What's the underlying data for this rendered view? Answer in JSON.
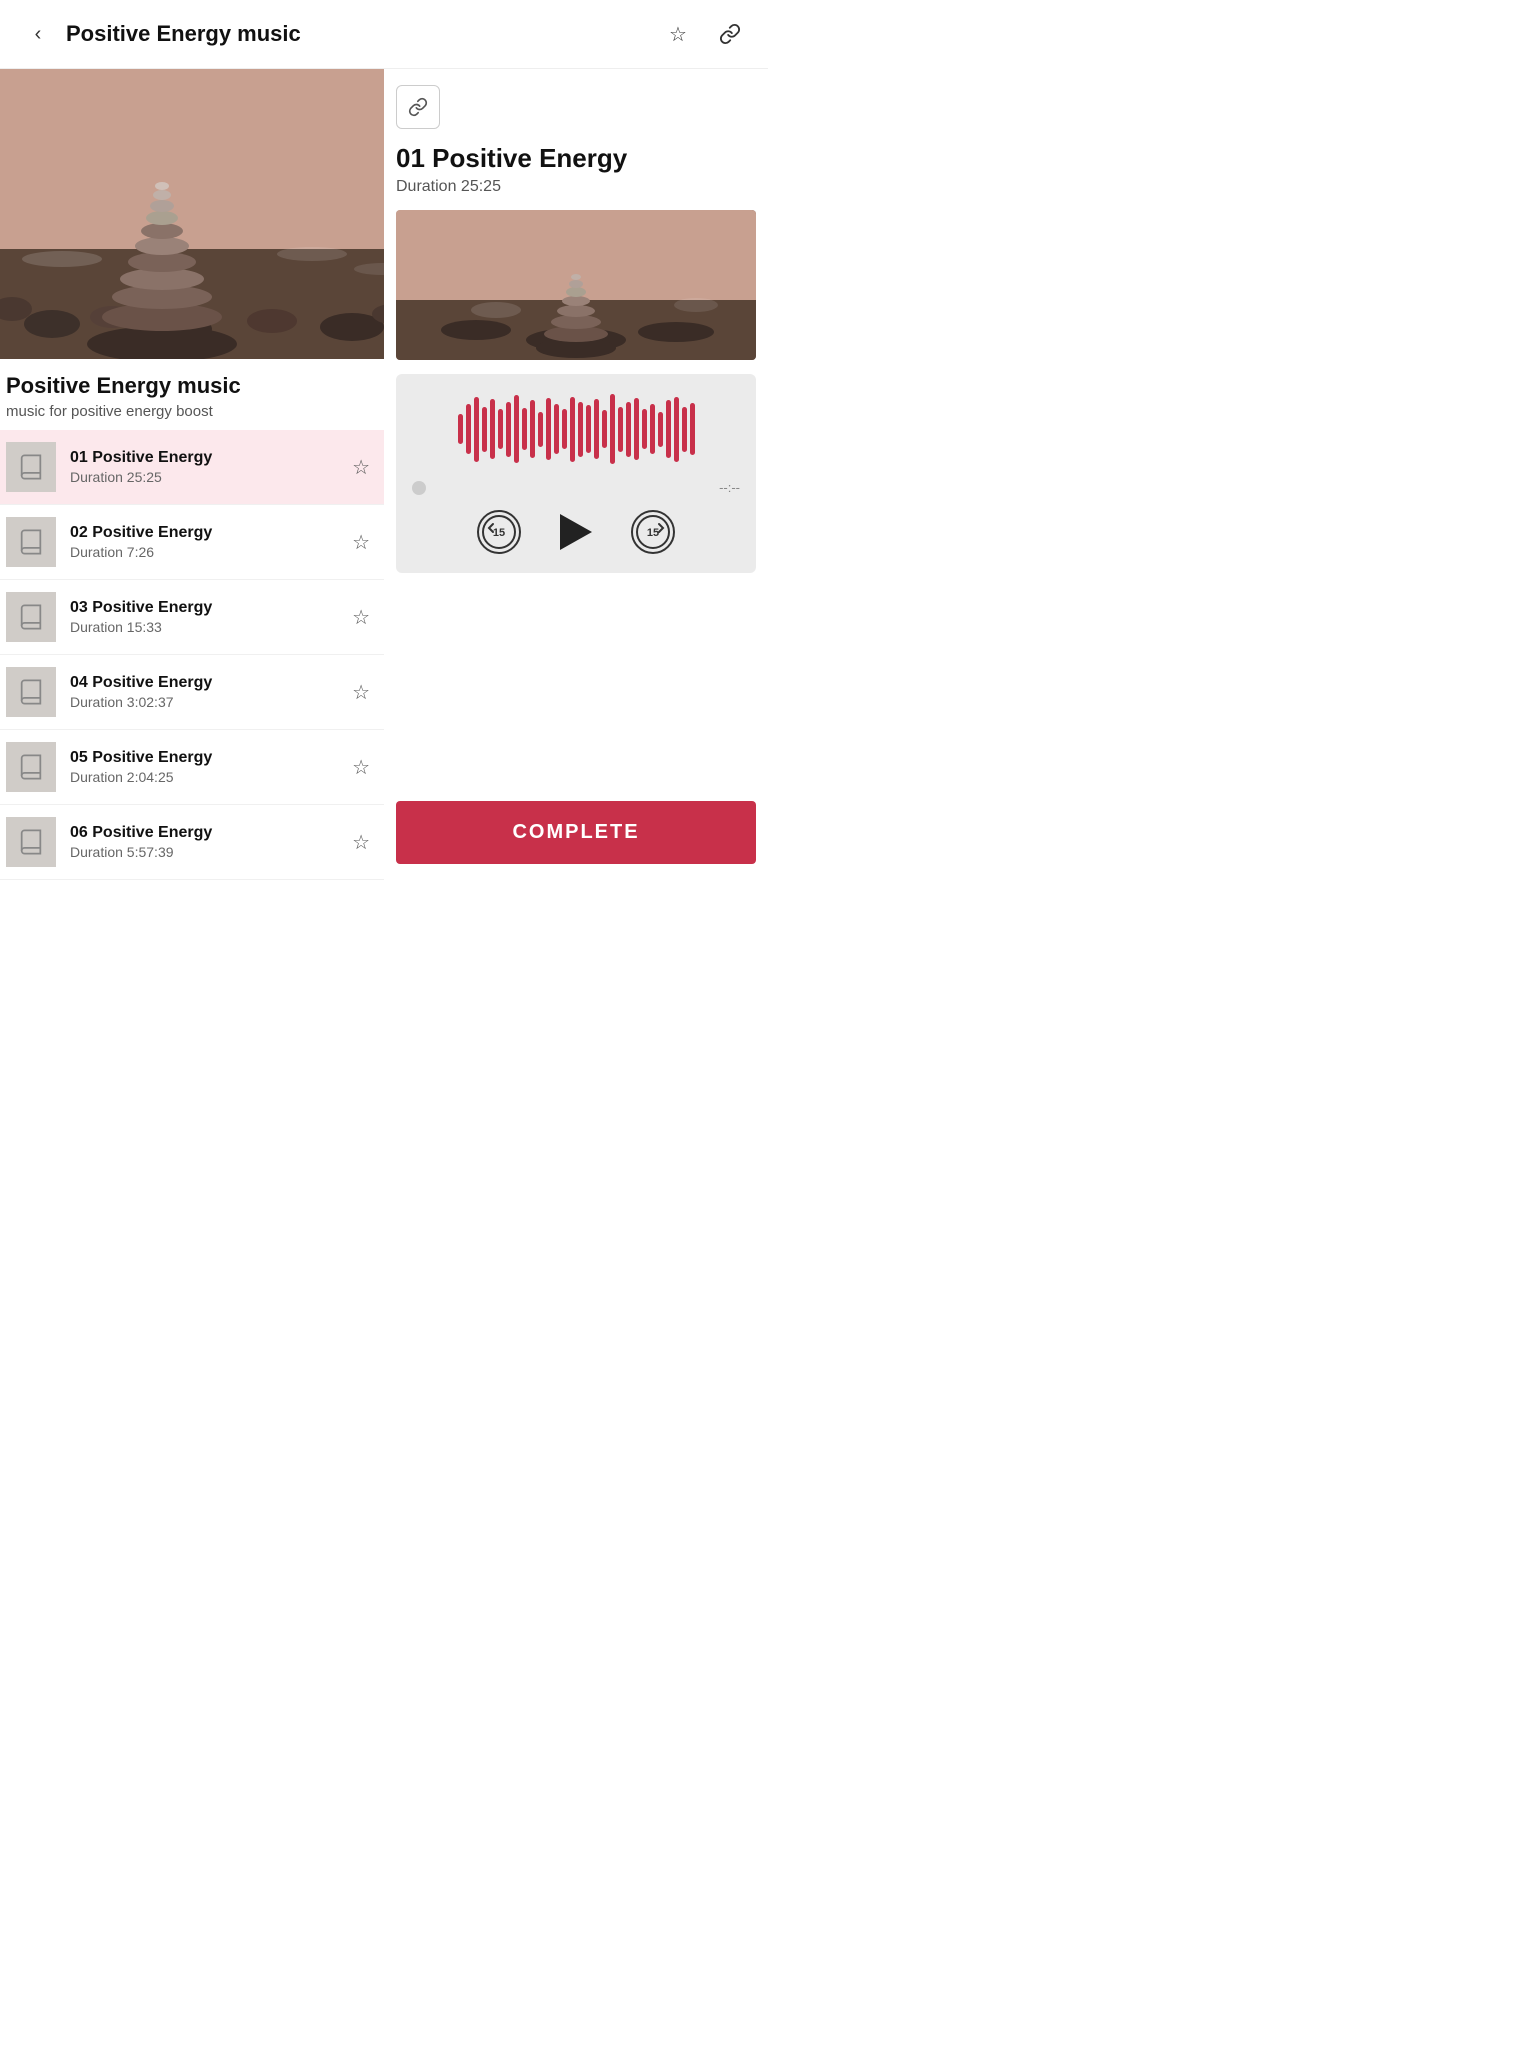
{
  "header": {
    "back_label": "‹",
    "title": "Positive Energy music",
    "star_icon": "☆",
    "link_icon": "🔗"
  },
  "playlist": {
    "title": "Positive Energy music",
    "description": "music for positive energy boost"
  },
  "tracks": [
    {
      "id": 1,
      "name": "01 Positive Energy",
      "duration": "Duration 25:25",
      "active": true
    },
    {
      "id": 2,
      "name": "02 Positive Energy",
      "duration": "Duration 7:26",
      "active": false
    },
    {
      "id": 3,
      "name": "03 Positive Energy",
      "duration": "Duration 15:33",
      "active": false
    },
    {
      "id": 4,
      "name": "04 Positive Energy",
      "duration": "Duration 3:02:37",
      "active": false
    },
    {
      "id": 5,
      "name": "05 Positive Energy",
      "duration": "Duration 2:04:25",
      "active": false
    },
    {
      "id": 6,
      "name": "06 Positive Energy",
      "duration": "Duration 5:57:39",
      "active": false
    }
  ],
  "detail": {
    "link_icon": "🔗",
    "title": "01 Positive Energy",
    "duration": "Duration 25:25",
    "skip_back": "15",
    "skip_forward": "15",
    "time_display": "--:--"
  },
  "complete_btn": "COMPLETE",
  "waveform_heights": [
    30,
    50,
    65,
    45,
    60,
    40,
    55,
    68,
    42,
    58,
    35,
    62,
    50,
    40,
    65,
    55,
    48,
    60,
    38,
    70,
    45,
    55,
    62,
    40,
    50,
    35,
    58,
    65,
    45,
    52
  ]
}
